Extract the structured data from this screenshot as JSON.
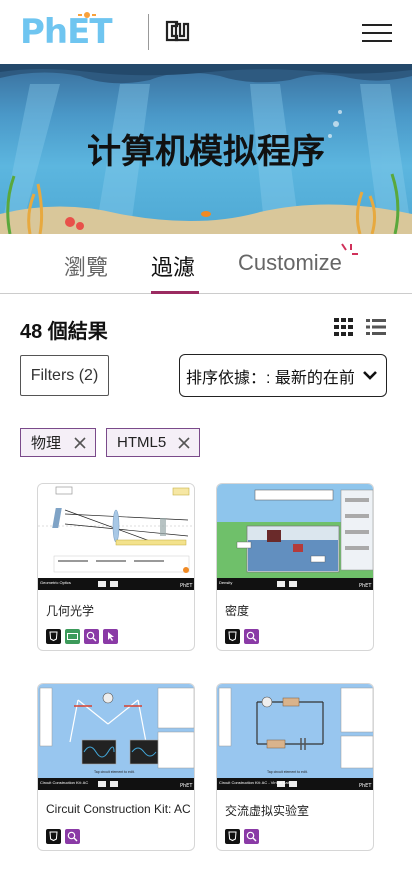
{
  "header": {
    "logo_text": "PhET",
    "menu_icon": "hamburger-menu-icon"
  },
  "banner": {
    "title": "计算机模拟程序"
  },
  "tabs": [
    {
      "label": "瀏覽",
      "active": false
    },
    {
      "label": "過濾",
      "active": true
    },
    {
      "label": "Customize",
      "active": false
    }
  ],
  "results": {
    "count_text": "48 個結果"
  },
  "filters_button": {
    "label": "Filters (2)"
  },
  "sort": {
    "label": "排序依據：: 最新的在前"
  },
  "active_filters": [
    {
      "label": "物理"
    },
    {
      "label": "HTML5"
    }
  ],
  "colors": {
    "accent": "#9b2b61",
    "chip_border": "#7a4a8a",
    "phet_blue": "#6fc5f0",
    "phet_orange": "#f9a13a"
  },
  "cards": [
    {
      "title": "几何光学",
      "thumb_caption": "Geometric Optics",
      "badges": [
        "html5-icon",
        "keyboard-icon",
        "zoom-icon",
        "interactive-icon"
      ]
    },
    {
      "title": "密度",
      "thumb_caption": "Density",
      "badges": [
        "html5-icon",
        "zoom-icon"
      ]
    },
    {
      "title": "Circuit Construction Kit: AC",
      "thumb_caption": "Circuit Construction Kit: AC",
      "thumb_hint": "Tap circuit element to edit.",
      "badges": [
        "html5-icon",
        "zoom-icon"
      ]
    },
    {
      "title": "交流虚拟实验室",
      "thumb_caption": "Circuit Construction Kit: AC - Virtual Lab",
      "thumb_hint": "Tap circuit element to edit.",
      "badges": [
        "html5-icon",
        "zoom-icon"
      ]
    }
  ]
}
